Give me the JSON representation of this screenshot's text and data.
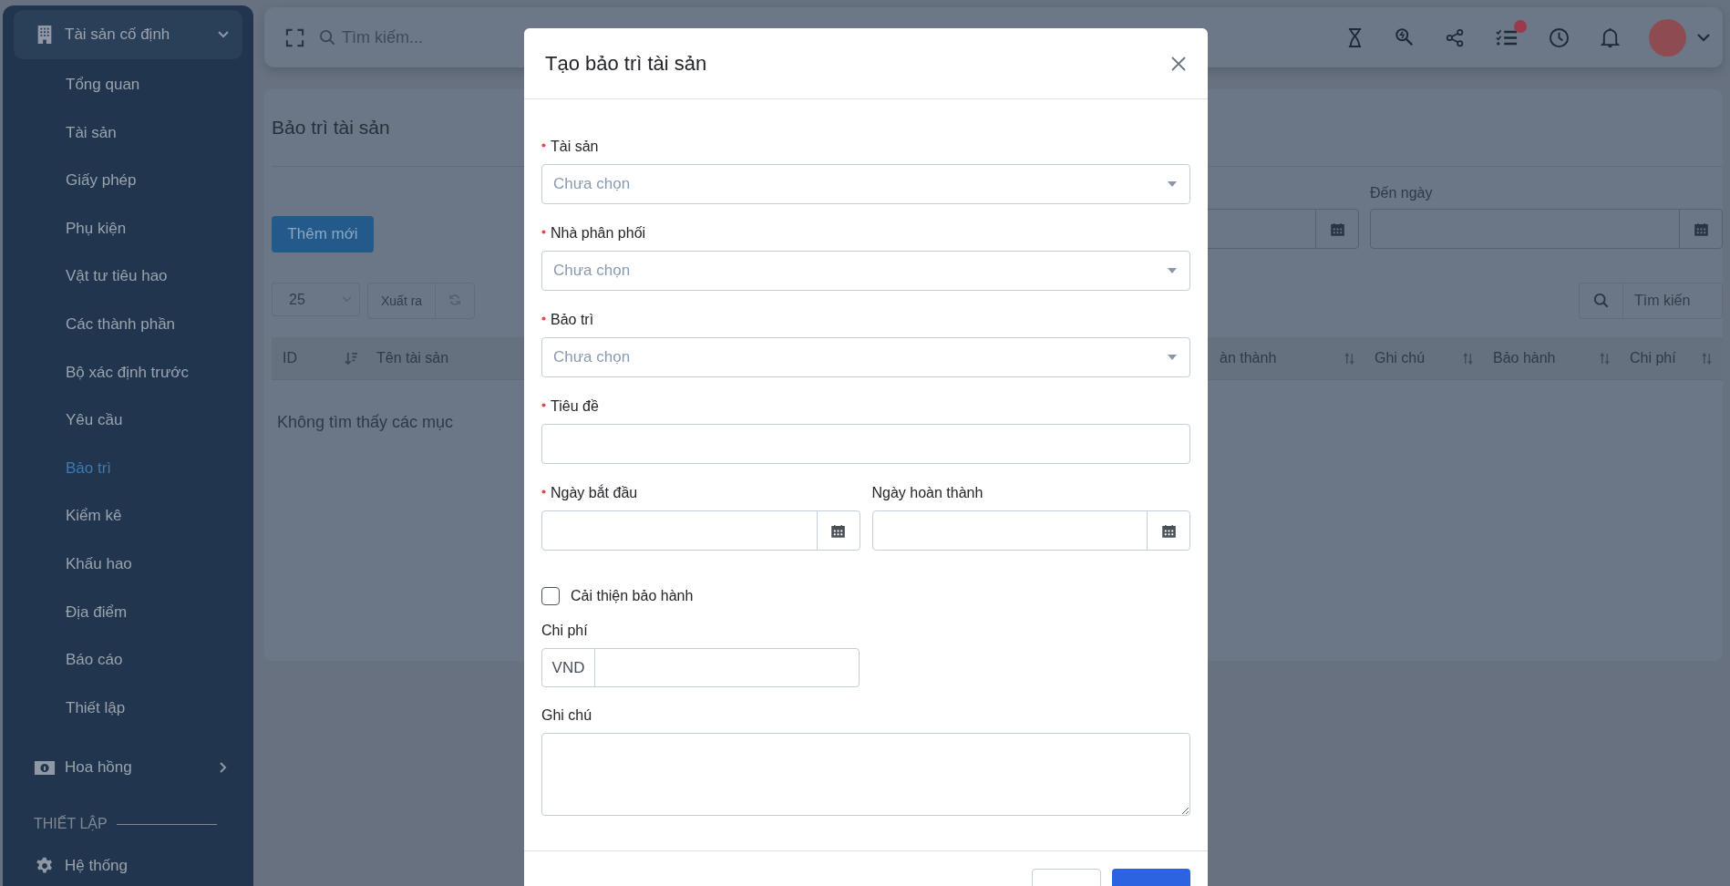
{
  "sidebar": {
    "module": {
      "label": "Tài sản cố định",
      "expanded": true
    },
    "items": [
      {
        "label": "Tổng quan",
        "selected": false
      },
      {
        "label": "Tài sản",
        "selected": false
      },
      {
        "label": "Giấy phép",
        "selected": false
      },
      {
        "label": "Phụ kiện",
        "selected": false
      },
      {
        "label": "Vật tư tiêu hao",
        "selected": false
      },
      {
        "label": "Các thành phần",
        "selected": false
      },
      {
        "label": "Bộ xác định trước",
        "selected": false
      },
      {
        "label": "Yêu cầu",
        "selected": false
      },
      {
        "label": "Bảo trì",
        "selected": true
      },
      {
        "label": "Kiểm kê",
        "selected": false
      },
      {
        "label": "Khấu hao",
        "selected": false
      },
      {
        "label": "Địa điểm",
        "selected": false
      },
      {
        "label": "Báo cáo",
        "selected": false
      },
      {
        "label": "Thiết lập",
        "selected": false
      }
    ],
    "commission": {
      "label": "Hoa hồng",
      "expanded": false
    },
    "section_label": "THIẾT LẬP",
    "system": {
      "label": "Hệ thống"
    }
  },
  "topbar": {
    "search_placeholder": "Tìm kiếm..."
  },
  "page": {
    "title": "Bảo trì tài sản",
    "to_date_label": "Đến ngày",
    "add_button": "Thêm mới",
    "page_size": "25",
    "export_button": "Xuất ra",
    "search_placeholder": "Tìm kiến",
    "columns_left": [
      "ID",
      "Tên tài sản"
    ],
    "columns_right": [
      "àn thành",
      "Ghi chú",
      "Bảo hành",
      "Chi phí"
    ],
    "empty_message": "Không tìm thấy các mục"
  },
  "modal": {
    "title": "Tạo bảo trì tài sản",
    "fields": [
      {
        "kind": "select",
        "label": "Tài sản",
        "required": true,
        "placeholder": "Chưa chọn"
      },
      {
        "kind": "select",
        "label": "Nhà phân phối",
        "required": true,
        "placeholder": "Chưa chọn"
      },
      {
        "kind": "select",
        "label": "Bảo trì",
        "required": true,
        "placeholder": "Chưa chọn"
      },
      {
        "kind": "text",
        "label": "Tiêu đề",
        "required": true
      }
    ],
    "dates": [
      {
        "label": "Ngày bắt đầu",
        "required": true
      },
      {
        "label": "Ngày hoàn thành",
        "required": false
      }
    ],
    "warranty": {
      "label": "Cải thiện bảo hành",
      "checked": false
    },
    "cost": {
      "label": "Chi phí",
      "currency": "VND"
    },
    "notes": {
      "label": "Ghi chú"
    }
  }
}
